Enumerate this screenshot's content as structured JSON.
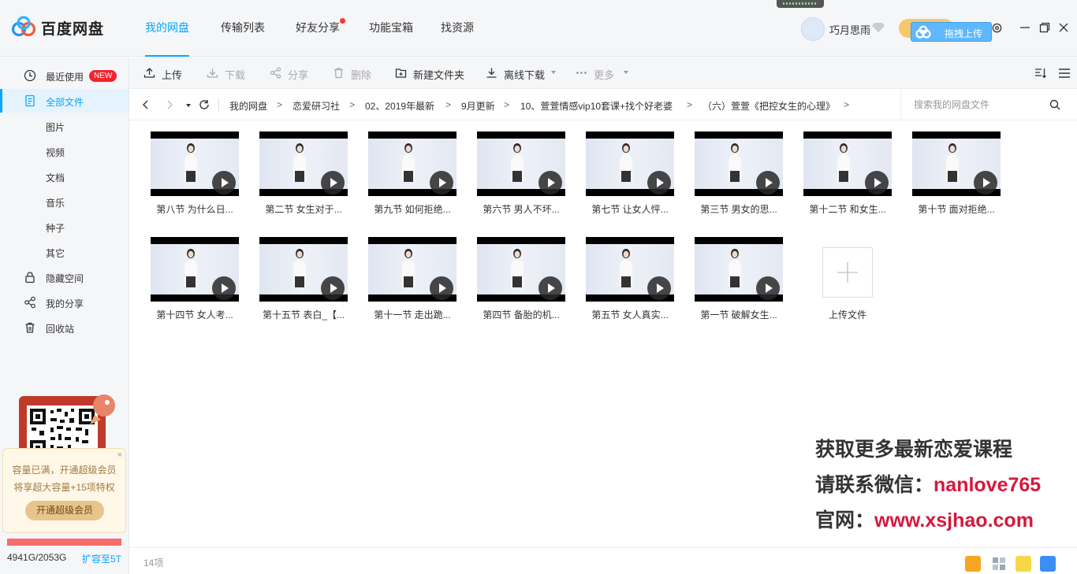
{
  "app": {
    "name": "百度网盘"
  },
  "nav": [
    "我的网盘",
    "传输列表",
    "好友分享",
    "功能宝箱",
    "找资源"
  ],
  "user": {
    "name": "巧月思雨"
  },
  "upload_float": {
    "label": "拖拽上传"
  },
  "sidebar": {
    "items": [
      {
        "label": "最近使用",
        "badge": "NEW",
        "icon": "clock-icon"
      },
      {
        "label": "全部文件",
        "icon": "file-icon"
      },
      {
        "label": "图片"
      },
      {
        "label": "视频"
      },
      {
        "label": "文档"
      },
      {
        "label": "音乐"
      },
      {
        "label": "种子"
      },
      {
        "label": "其它"
      },
      {
        "label": "隐藏空间",
        "icon": "lock-icon"
      },
      {
        "label": "我的分享",
        "icon": "share-icon"
      },
      {
        "label": "回收站",
        "icon": "trash-icon"
      }
    ],
    "promo": {
      "line1": "容量已满，开通超级会员",
      "line2": "将享超大容量+15项特权",
      "button": "开通超级会员",
      "close": "×"
    },
    "quota": {
      "used": "4941G/2053G",
      "expand": "扩容至5T"
    }
  },
  "toolbar": {
    "upload": "上传",
    "download": "下载",
    "share": "分享",
    "delete": "删除",
    "new_folder": "新建文件夹",
    "offline": "离线下载",
    "more": "更多"
  },
  "breadcrumb": [
    "我的网盘",
    "恋爱研习社",
    "02、2019年最新",
    "9月更新",
    "10、萱萱情感vip10套课+找个好老婆",
    "（六）萱萱《把控女生的心理》"
  ],
  "search": {
    "placeholder": "搜索我的网盘文件"
  },
  "files": [
    {
      "name": "第八节 为什么日..."
    },
    {
      "name": "第二节 女生对于..."
    },
    {
      "name": "第九节  如何拒绝..."
    },
    {
      "name": "第六节 男人不坏..."
    },
    {
      "name": "第七节 让女人怦..."
    },
    {
      "name": "第三节 男女的思..."
    },
    {
      "name": "第十二节 和女生..."
    },
    {
      "name": "第十节 面对拒绝..."
    },
    {
      "name": "第十四节 女人考..."
    },
    {
      "name": "第十五节 表白_【..."
    },
    {
      "name": "第十一节 走出跪..."
    },
    {
      "name": "第四节 备胎的机..."
    },
    {
      "name": "第五节 女人真实..."
    },
    {
      "name": "第一节 破解女生..."
    }
  ],
  "upload_tile": {
    "label": "上传文件"
  },
  "watermark": {
    "line1": "获取更多最新恋爱课程",
    "line2_prefix": "请联系微信：",
    "line2_value": "nanlove765",
    "line3_prefix": "官网：",
    "line3_value": "www.xsjhao.com"
  },
  "status": {
    "count": "14项"
  },
  "colors": {
    "accent": "#06a7ff",
    "watermark_red": "#d6183b"
  }
}
